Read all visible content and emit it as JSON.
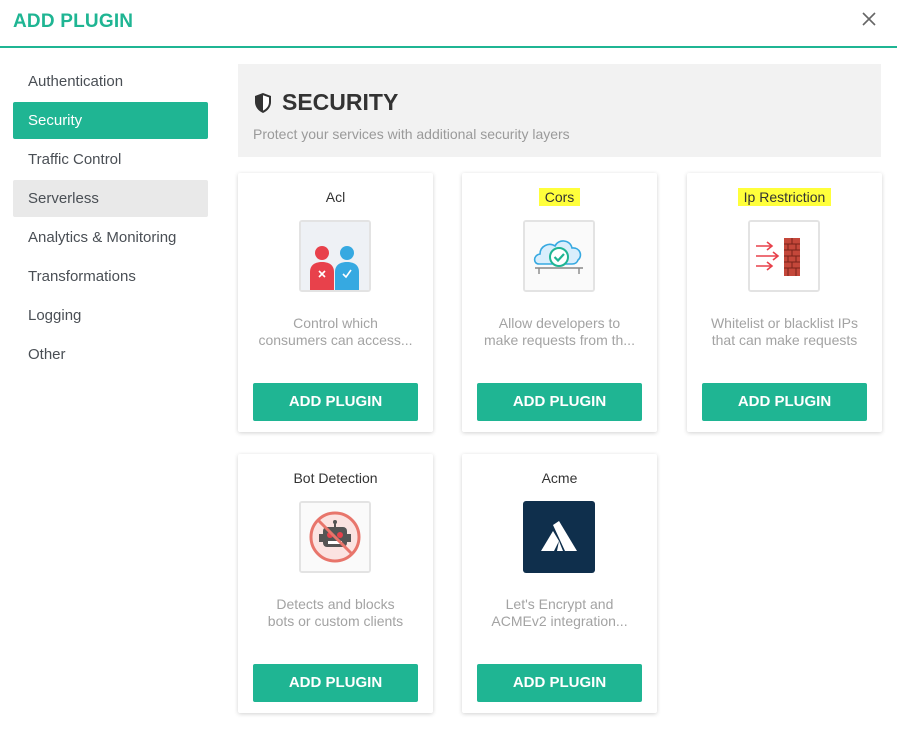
{
  "modal": {
    "title": "ADD PLUGIN"
  },
  "sidebar": {
    "items": [
      {
        "label": "Authentication"
      },
      {
        "label": "Security"
      },
      {
        "label": "Traffic Control"
      },
      {
        "label": "Serverless"
      },
      {
        "label": "Analytics & Monitoring"
      },
      {
        "label": "Transformations"
      },
      {
        "label": "Logging"
      },
      {
        "label": "Other"
      }
    ]
  },
  "category": {
    "title": "SECURITY",
    "description": "Protect your services with additional security layers"
  },
  "plugins": [
    {
      "name": "Acl",
      "desc_line1": "Control which",
      "desc_line2": "consumers can access...",
      "button": "ADD PLUGIN"
    },
    {
      "name": "Cors",
      "desc_line1": "Allow developers to",
      "desc_line2": "make requests from th...",
      "button": "ADD PLUGIN"
    },
    {
      "name": "Ip Restriction",
      "desc_line1": "Whitelist or blacklist IPs",
      "desc_line2": "that can make requests",
      "button": "ADD PLUGIN"
    },
    {
      "name": "Bot Detection",
      "desc_line1": "Detects and blocks",
      "desc_line2": "bots or custom clients",
      "button": "ADD PLUGIN"
    },
    {
      "name": "Acme",
      "desc_line1": "Let's Encrypt and",
      "desc_line2": "ACMEv2 integration...",
      "button": "ADD PLUGIN"
    }
  ],
  "colors": {
    "accent": "#1fb593",
    "highlight": "#ffff3b",
    "header_bg": "#f2f2f2"
  }
}
